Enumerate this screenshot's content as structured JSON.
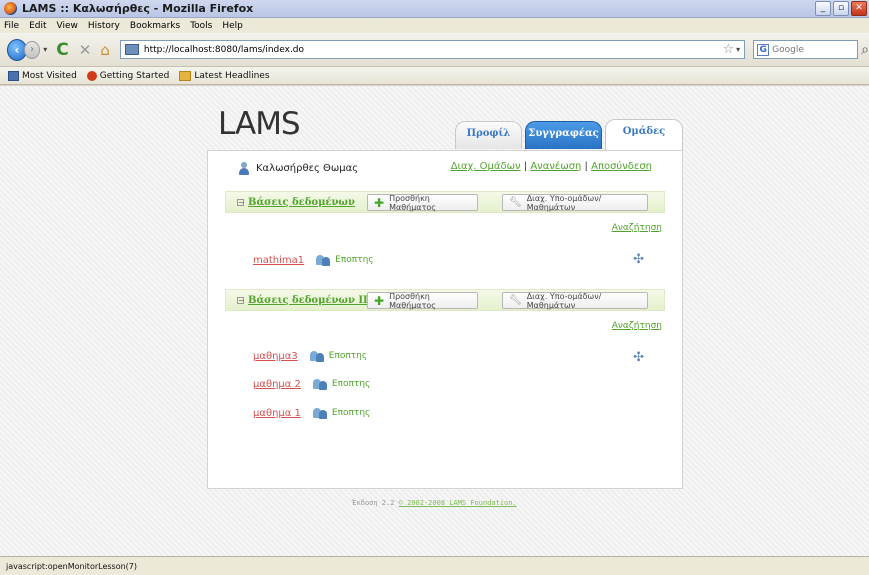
{
  "window": {
    "title": "LAMS :: Καλωσήρθες - Mozilla Firefox"
  },
  "menu": [
    "File",
    "Edit",
    "View",
    "History",
    "Bookmarks",
    "Tools",
    "Help"
  ],
  "nav": {
    "url": "http://localhost:8080/lams/index.do",
    "search_placeholder": "Google"
  },
  "bookmarks": [
    "Most Visited",
    "Getting Started",
    "Latest Headlines"
  ],
  "page": {
    "logo": "LAMS",
    "tabs": {
      "profile": "Προφίλ",
      "authors": "Συγγραφέας",
      "groups": "Ομάδες"
    },
    "user_name": "Καλωσήρθες Θωμας",
    "links": {
      "manage_groups": "Διαχ. Ομάδων",
      "refresh": "Ανανέωση",
      "logout": "Αποσύνδεση",
      "sep": " | "
    },
    "orgs": [
      {
        "name": "Βάσεις δεδομένων",
        "add_lesson": "Προσθήκη Μαθήματος",
        "manage_sub": "Διαχ. Υπο-ομάδων/Μαθημάτων",
        "search": "Αναζήτηση",
        "lessons": [
          {
            "name": "mathima1",
            "monitor": "Εποπτης"
          }
        ]
      },
      {
        "name": "Βάσεις δεδομένων ΙΙ",
        "add_lesson": "Προσθήκη Μαθήματος",
        "manage_sub": "Διαχ. Υπο-ομάδων/Μαθημάτων",
        "search": "Αναζήτηση",
        "lessons": [
          {
            "name": "μαθημα3",
            "monitor": "Εποπτης"
          },
          {
            "name": "μαθημα 2",
            "monitor": "Εποπτης"
          },
          {
            "name": "μαθημα 1",
            "monitor": "Εποπτης"
          }
        ]
      }
    ],
    "footer": {
      "version": "Έκδοση 2.2",
      "copyright": "© 2002-2008 LAMS Foundation."
    }
  },
  "status_text": "javascript:openMonitorLesson(7)"
}
